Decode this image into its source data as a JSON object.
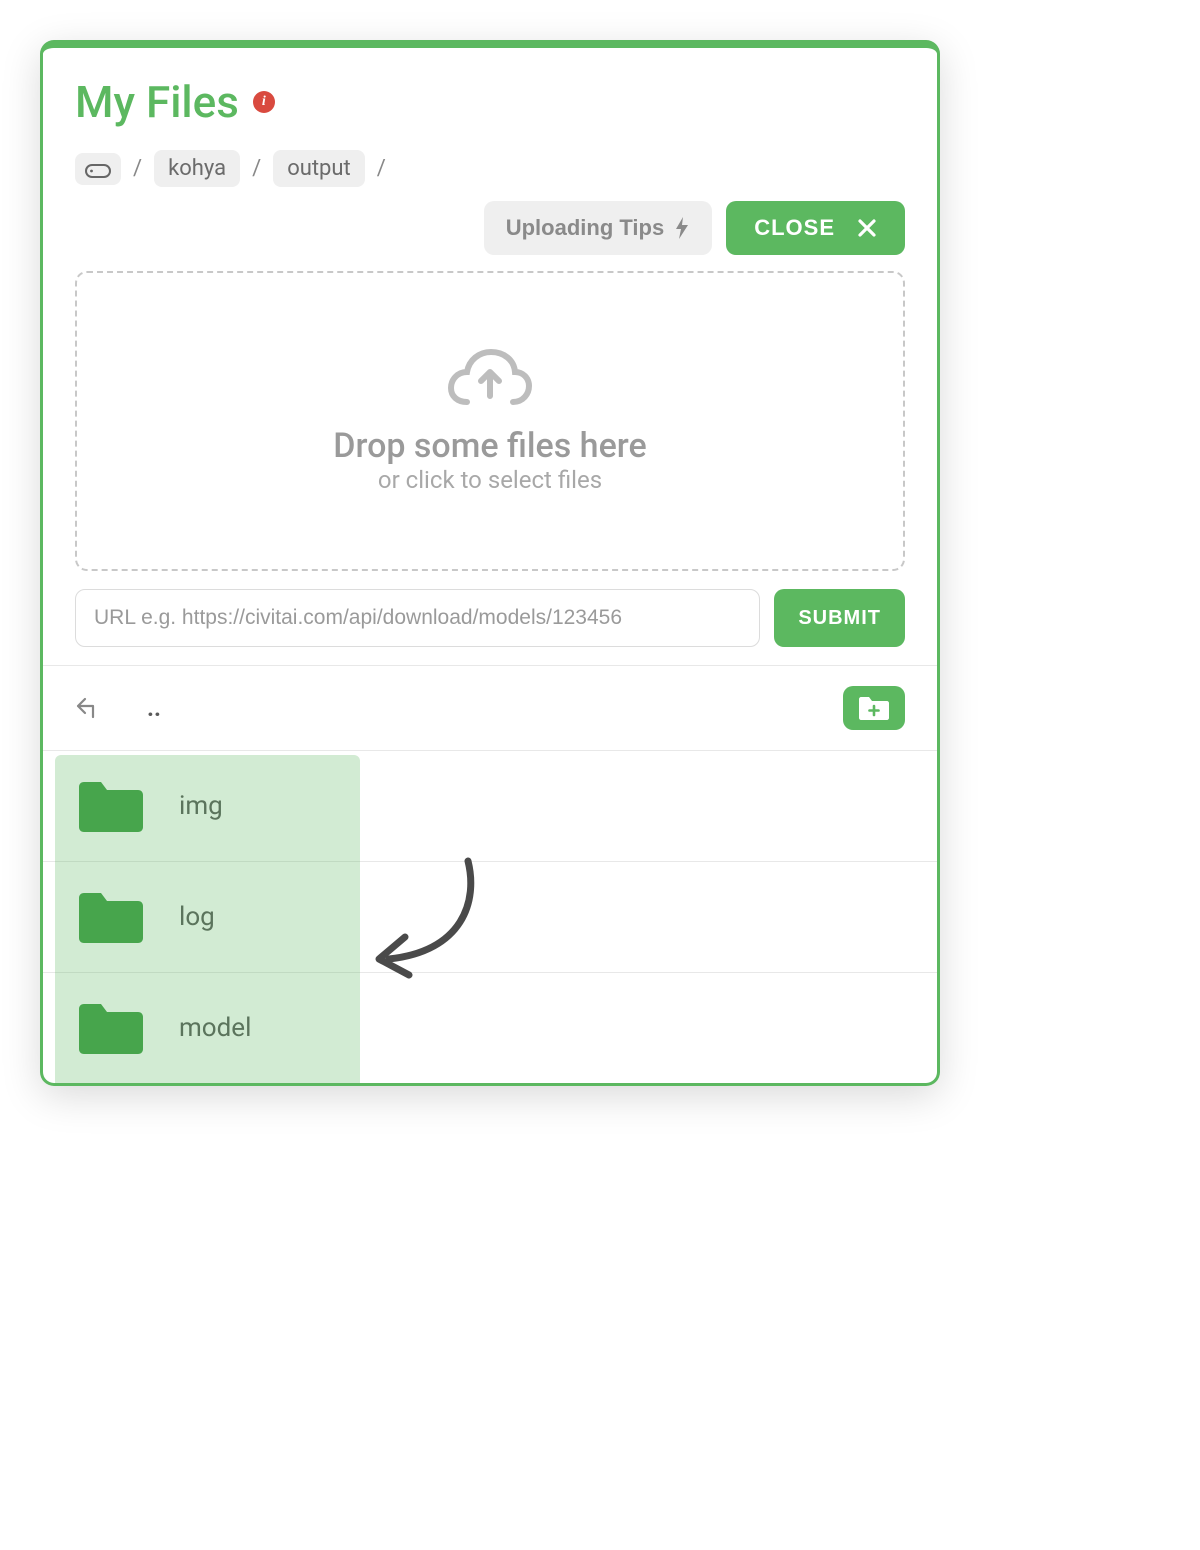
{
  "header": {
    "title": "My Files",
    "info_icon": "i"
  },
  "breadcrumb": {
    "items": [
      "kohya",
      "output"
    ],
    "separator": "/"
  },
  "actions": {
    "tips_label": "Uploading Tips",
    "close_label": "CLOSE"
  },
  "dropzone": {
    "title": "Drop some files here",
    "subtitle": "or click to select files"
  },
  "url": {
    "placeholder": "URL e.g. https://civitai.com/api/download/models/123456",
    "submit_label": "SUBMIT"
  },
  "nav": {
    "up_label": ".."
  },
  "files": [
    {
      "name": "img",
      "type": "folder"
    },
    {
      "name": "log",
      "type": "folder"
    },
    {
      "name": "model",
      "type": "folder"
    }
  ],
  "colors": {
    "accent": "#5cb860",
    "danger": "#d94a3f",
    "muted": "#9a9a9a"
  }
}
